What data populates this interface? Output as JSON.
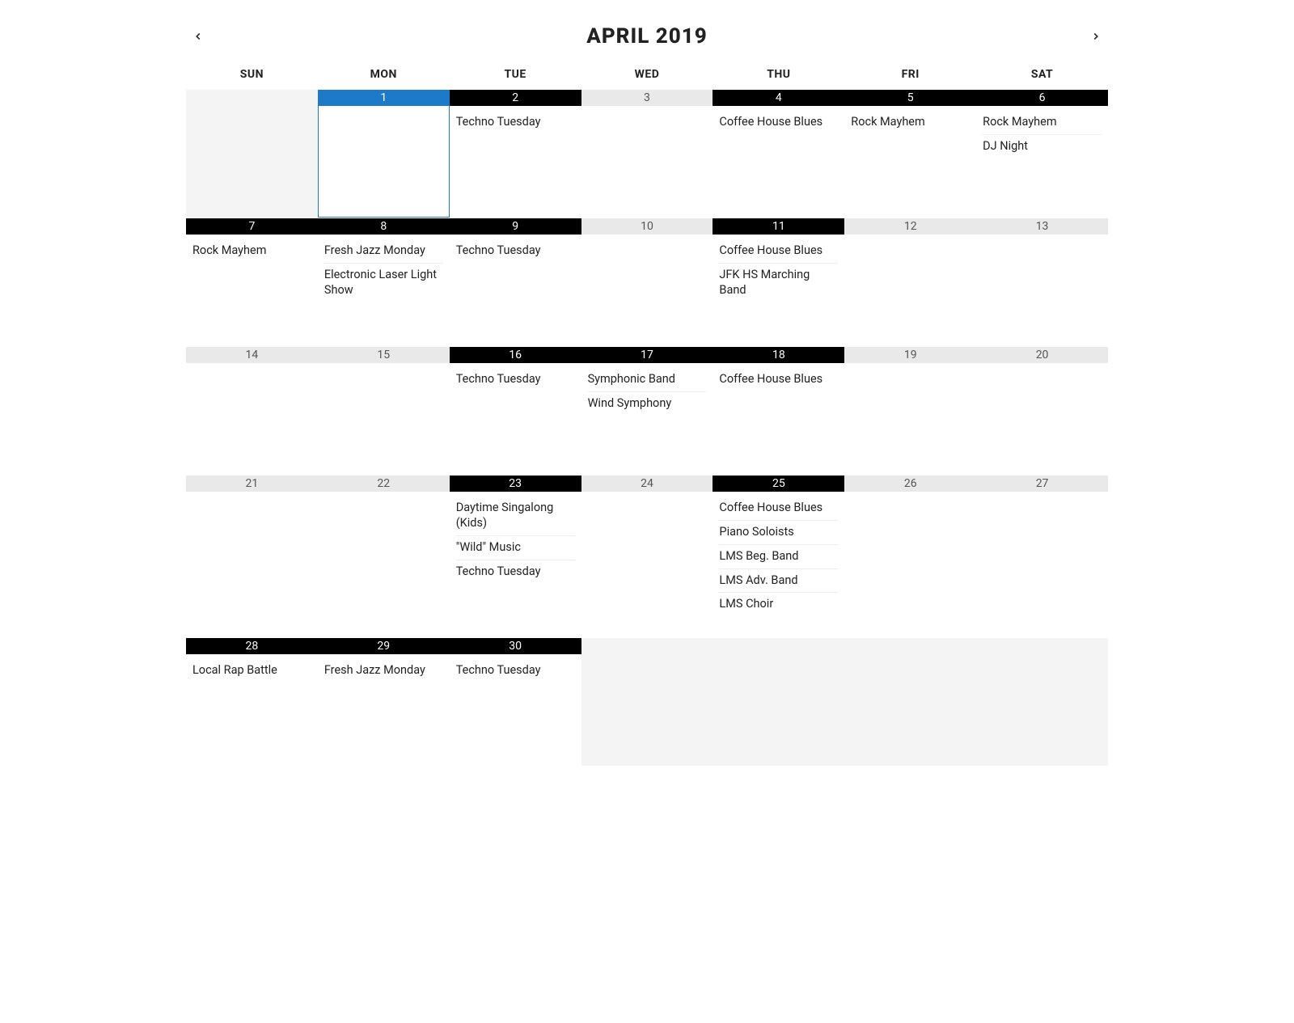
{
  "header": {
    "title": "APRIL 2019"
  },
  "dow": [
    "SUN",
    "MON",
    "TUE",
    "WED",
    "THU",
    "FRI",
    "SAT"
  ],
  "weeks": [
    [
      {
        "date": "",
        "bar": "none",
        "events": [],
        "padding": true
      },
      {
        "date": "1",
        "bar": "active",
        "events": [],
        "selected": true
      },
      {
        "date": "2",
        "bar": "dark",
        "events": [
          "Techno Tuesday"
        ]
      },
      {
        "date": "3",
        "bar": "light",
        "events": []
      },
      {
        "date": "4",
        "bar": "dark",
        "events": [
          "Coffee House Blues"
        ]
      },
      {
        "date": "5",
        "bar": "dark",
        "events": [
          "Rock Mayhem"
        ]
      },
      {
        "date": "6",
        "bar": "dark",
        "events": [
          "Rock Mayhem",
          "DJ Night"
        ]
      }
    ],
    [
      {
        "date": "7",
        "bar": "dark",
        "events": [
          "Rock Mayhem"
        ]
      },
      {
        "date": "8",
        "bar": "dark",
        "events": [
          "Fresh Jazz Monday",
          "Electronic Laser Light Show"
        ]
      },
      {
        "date": "9",
        "bar": "dark",
        "events": [
          "Techno Tuesday"
        ]
      },
      {
        "date": "10",
        "bar": "light",
        "events": []
      },
      {
        "date": "11",
        "bar": "dark",
        "events": [
          "Coffee House Blues",
          "JFK HS Marching Band"
        ]
      },
      {
        "date": "12",
        "bar": "light",
        "events": []
      },
      {
        "date": "13",
        "bar": "light",
        "events": []
      }
    ],
    [
      {
        "date": "14",
        "bar": "light",
        "events": []
      },
      {
        "date": "15",
        "bar": "light",
        "events": []
      },
      {
        "date": "16",
        "bar": "dark",
        "events": [
          "Techno Tuesday"
        ]
      },
      {
        "date": "17",
        "bar": "dark",
        "events": [
          "Symphonic Band",
          "Wind Symphony"
        ]
      },
      {
        "date": "18",
        "bar": "dark",
        "events": [
          "Coffee House Blues"
        ]
      },
      {
        "date": "19",
        "bar": "light",
        "events": []
      },
      {
        "date": "20",
        "bar": "light",
        "events": []
      }
    ],
    [
      {
        "date": "21",
        "bar": "light",
        "events": []
      },
      {
        "date": "22",
        "bar": "light",
        "events": []
      },
      {
        "date": "23",
        "bar": "dark",
        "events": [
          "Daytime Singalong (Kids)",
          "\"Wild\" Music",
          "Techno Tuesday"
        ]
      },
      {
        "date": "24",
        "bar": "light",
        "events": []
      },
      {
        "date": "25",
        "bar": "dark",
        "events": [
          "Coffee House Blues",
          "Piano Soloists",
          "LMS Beg. Band",
          "LMS Adv. Band",
          "LMS Choir"
        ]
      },
      {
        "date": "26",
        "bar": "light",
        "events": []
      },
      {
        "date": "27",
        "bar": "light",
        "events": []
      }
    ],
    [
      {
        "date": "28",
        "bar": "dark",
        "events": [
          "Local Rap Battle"
        ]
      },
      {
        "date": "29",
        "bar": "dark",
        "events": [
          "Fresh Jazz Monday"
        ]
      },
      {
        "date": "30",
        "bar": "dark",
        "events": [
          "Techno Tuesday"
        ]
      },
      {
        "date": "",
        "bar": "none",
        "events": [],
        "padding": true
      },
      {
        "date": "",
        "bar": "none",
        "events": [],
        "padding": true
      },
      {
        "date": "",
        "bar": "none",
        "events": [],
        "padding": true
      },
      {
        "date": "",
        "bar": "none",
        "events": [],
        "padding": true
      }
    ]
  ]
}
